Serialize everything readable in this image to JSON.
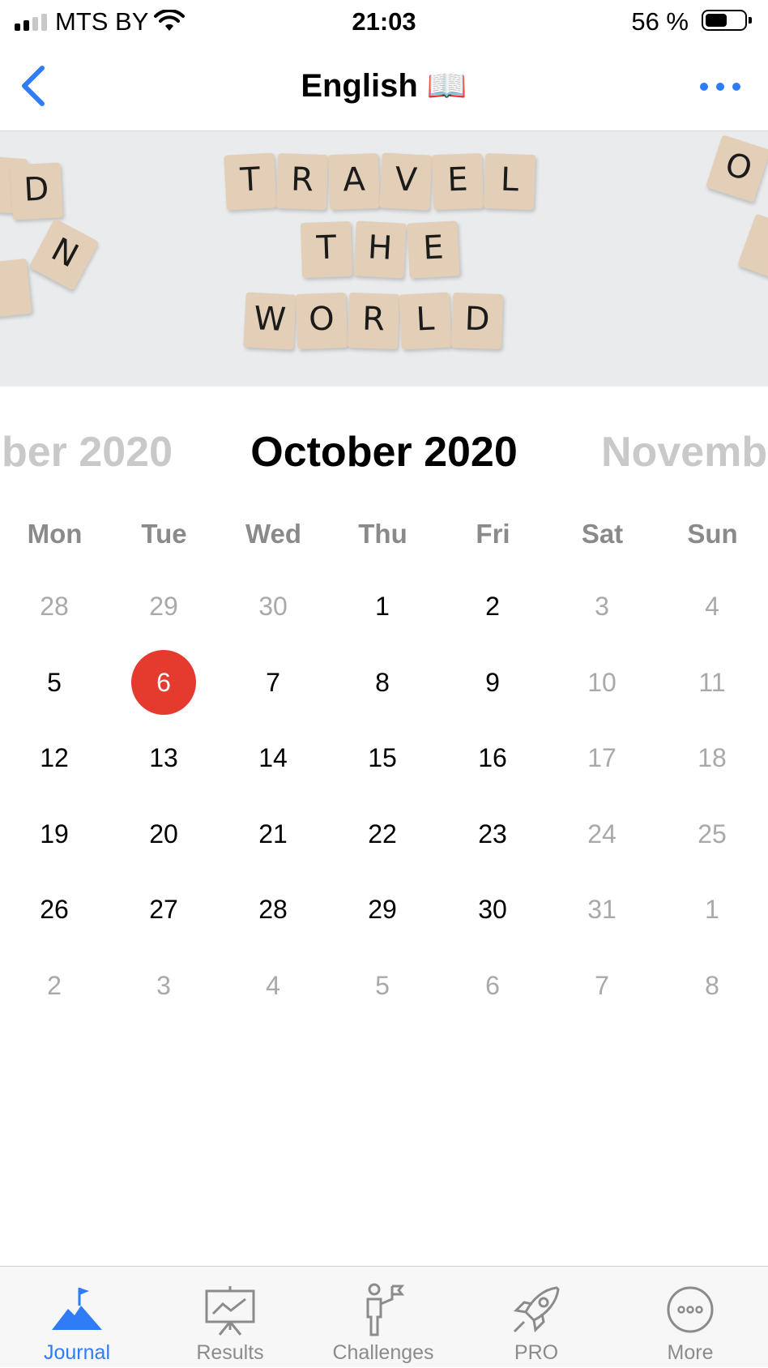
{
  "status_bar": {
    "carrier": "MTS BY",
    "time": "21:03",
    "battery": "56 %",
    "battery_level": 0.56
  },
  "nav": {
    "title": "English 📖",
    "back_icon": "chevron-left-icon",
    "more_icon": "ellipsis-icon"
  },
  "banner": {
    "alt": "scrabble tiles photo",
    "words": [
      "TRAVEL",
      "THE",
      "WORLD"
    ]
  },
  "calendar": {
    "prev_month": "ber 2020",
    "current_month": "October 2020",
    "next_month": "Novemb",
    "weekdays": [
      "Mon",
      "Tue",
      "Wed",
      "Thu",
      "Fri",
      "Sat",
      "Sun"
    ],
    "weeks": [
      [
        {
          "d": "28",
          "s": "out"
        },
        {
          "d": "29",
          "s": "out"
        },
        {
          "d": "30",
          "s": "out"
        },
        {
          "d": "1",
          "s": "in"
        },
        {
          "d": "2",
          "s": "in"
        },
        {
          "d": "3",
          "s": "weekend"
        },
        {
          "d": "4",
          "s": "weekend"
        }
      ],
      [
        {
          "d": "5",
          "s": "in"
        },
        {
          "d": "6",
          "s": "selected"
        },
        {
          "d": "7",
          "s": "in"
        },
        {
          "d": "8",
          "s": "in"
        },
        {
          "d": "9",
          "s": "in"
        },
        {
          "d": "10",
          "s": "weekend"
        },
        {
          "d": "11",
          "s": "weekend"
        }
      ],
      [
        {
          "d": "12",
          "s": "in"
        },
        {
          "d": "13",
          "s": "in"
        },
        {
          "d": "14",
          "s": "in"
        },
        {
          "d": "15",
          "s": "in"
        },
        {
          "d": "16",
          "s": "in"
        },
        {
          "d": "17",
          "s": "weekend"
        },
        {
          "d": "18",
          "s": "weekend"
        }
      ],
      [
        {
          "d": "19",
          "s": "in"
        },
        {
          "d": "20",
          "s": "in"
        },
        {
          "d": "21",
          "s": "in"
        },
        {
          "d": "22",
          "s": "in"
        },
        {
          "d": "23",
          "s": "in"
        },
        {
          "d": "24",
          "s": "weekend"
        },
        {
          "d": "25",
          "s": "weekend"
        }
      ],
      [
        {
          "d": "26",
          "s": "in"
        },
        {
          "d": "27",
          "s": "in"
        },
        {
          "d": "28",
          "s": "in"
        },
        {
          "d": "29",
          "s": "in"
        },
        {
          "d": "30",
          "s": "in"
        },
        {
          "d": "31",
          "s": "weekend"
        },
        {
          "d": "1",
          "s": "out"
        }
      ],
      [
        {
          "d": "2",
          "s": "out"
        },
        {
          "d": "3",
          "s": "out"
        },
        {
          "d": "4",
          "s": "out"
        },
        {
          "d": "5",
          "s": "out"
        },
        {
          "d": "6",
          "s": "out"
        },
        {
          "d": "7",
          "s": "out"
        },
        {
          "d": "8",
          "s": "out"
        }
      ]
    ],
    "selected_color": "#e53b2f"
  },
  "tabs": [
    {
      "label": "Journal",
      "icon": "mountain-flag-icon",
      "active": true
    },
    {
      "label": "Results",
      "icon": "chart-board-icon",
      "active": false
    },
    {
      "label": "Challenges",
      "icon": "person-flag-icon",
      "active": false
    },
    {
      "label": "PRO",
      "icon": "rocket-icon",
      "active": false
    },
    {
      "label": "More",
      "icon": "more-circle-icon",
      "active": false
    }
  ],
  "colors": {
    "accent": "#2f7cf6",
    "inactive": "#8b8b8b"
  }
}
